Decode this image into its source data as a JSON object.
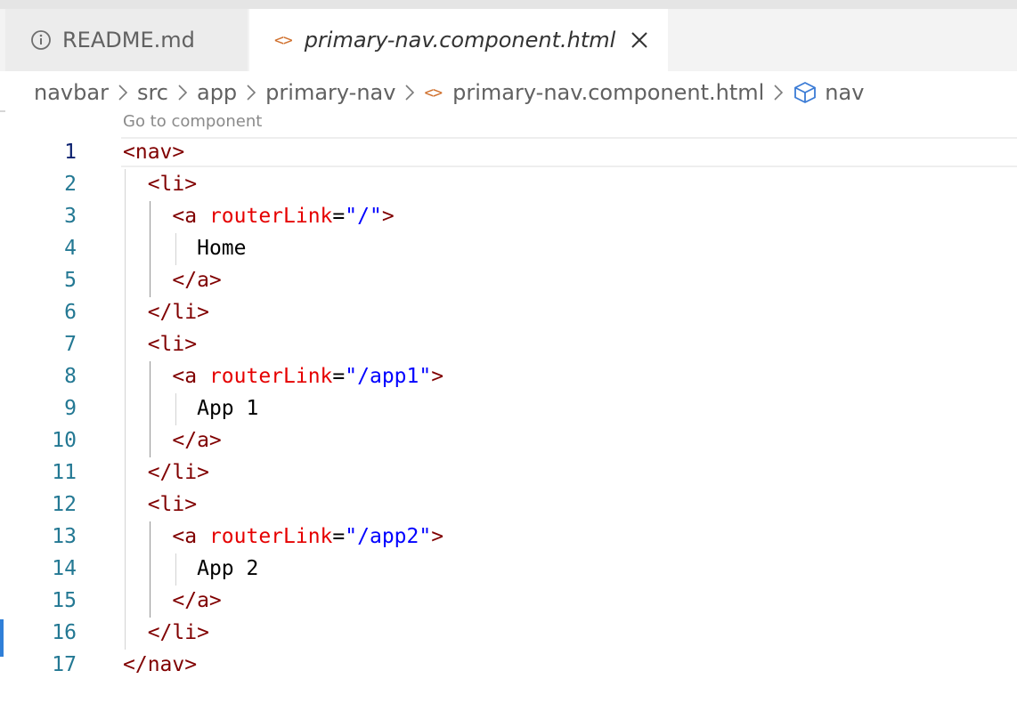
{
  "tabs": [
    {
      "label": "README.md",
      "icon": "info-icon",
      "active": false
    },
    {
      "label": "primary-nav.component.html",
      "icon": "code-brackets-icon",
      "active": true
    }
  ],
  "code_glyph": "<>",
  "breadcrumb": {
    "items": [
      "navbar",
      "src",
      "app",
      "primary-nav",
      "primary-nav.component.html",
      "nav"
    ]
  },
  "code_lens": "Go to component",
  "editor": {
    "active_line": 1,
    "lines": [
      {
        "n": "1",
        "tokens": [
          {
            "t": "tag",
            "v": "<nav>"
          }
        ]
      },
      {
        "n": "2",
        "tokens": [
          {
            "t": "ws",
            "v": "  "
          },
          {
            "t": "tag",
            "v": "<li>"
          }
        ]
      },
      {
        "n": "3",
        "tokens": [
          {
            "t": "ws",
            "v": "    "
          },
          {
            "t": "tag",
            "v": "<a "
          },
          {
            "t": "attr",
            "v": "routerLink"
          },
          {
            "t": "txt",
            "v": "="
          },
          {
            "t": "str",
            "v": "\"/\""
          },
          {
            "t": "tag",
            "v": ">"
          }
        ]
      },
      {
        "n": "4",
        "tokens": [
          {
            "t": "ws",
            "v": "      "
          },
          {
            "t": "txt",
            "v": "Home"
          }
        ]
      },
      {
        "n": "5",
        "tokens": [
          {
            "t": "ws",
            "v": "    "
          },
          {
            "t": "tag",
            "v": "</a>"
          }
        ]
      },
      {
        "n": "6",
        "tokens": [
          {
            "t": "ws",
            "v": "  "
          },
          {
            "t": "tag",
            "v": "</li>"
          }
        ]
      },
      {
        "n": "7",
        "tokens": [
          {
            "t": "ws",
            "v": "  "
          },
          {
            "t": "tag",
            "v": "<li>"
          }
        ]
      },
      {
        "n": "8",
        "tokens": [
          {
            "t": "ws",
            "v": "    "
          },
          {
            "t": "tag",
            "v": "<a "
          },
          {
            "t": "attr",
            "v": "routerLink"
          },
          {
            "t": "txt",
            "v": "="
          },
          {
            "t": "str",
            "v": "\"/app1\""
          },
          {
            "t": "tag",
            "v": ">"
          }
        ]
      },
      {
        "n": "9",
        "tokens": [
          {
            "t": "ws",
            "v": "      "
          },
          {
            "t": "txt",
            "v": "App 1"
          }
        ]
      },
      {
        "n": "10",
        "tokens": [
          {
            "t": "ws",
            "v": "    "
          },
          {
            "t": "tag",
            "v": "</a>"
          }
        ]
      },
      {
        "n": "11",
        "tokens": [
          {
            "t": "ws",
            "v": "  "
          },
          {
            "t": "tag",
            "v": "</li>"
          }
        ]
      },
      {
        "n": "12",
        "tokens": [
          {
            "t": "ws",
            "v": "  "
          },
          {
            "t": "tag",
            "v": "<li>"
          }
        ]
      },
      {
        "n": "13",
        "tokens": [
          {
            "t": "ws",
            "v": "    "
          },
          {
            "t": "tag",
            "v": "<a "
          },
          {
            "t": "attr",
            "v": "routerLink"
          },
          {
            "t": "txt",
            "v": "="
          },
          {
            "t": "str",
            "v": "\"/app2\""
          },
          {
            "t": "tag",
            "v": ">"
          }
        ]
      },
      {
        "n": "14",
        "tokens": [
          {
            "t": "ws",
            "v": "      "
          },
          {
            "t": "txt",
            "v": "App 2"
          }
        ]
      },
      {
        "n": "15",
        "tokens": [
          {
            "t": "ws",
            "v": "    "
          },
          {
            "t": "tag",
            "v": "</a>"
          }
        ]
      },
      {
        "n": "16",
        "tokens": [
          {
            "t": "ws",
            "v": "  "
          },
          {
            "t": "tag",
            "v": "</li>"
          }
        ]
      },
      {
        "n": "17",
        "tokens": [
          {
            "t": "tag",
            "v": "</nav>"
          }
        ]
      }
    ]
  },
  "colors": {
    "tag": "#800000",
    "attribute": "#e50000",
    "string": "#0000ff",
    "line_number": "#237893",
    "code_glyph": "#d0702d",
    "cube_icon": "#3a7bd5"
  }
}
